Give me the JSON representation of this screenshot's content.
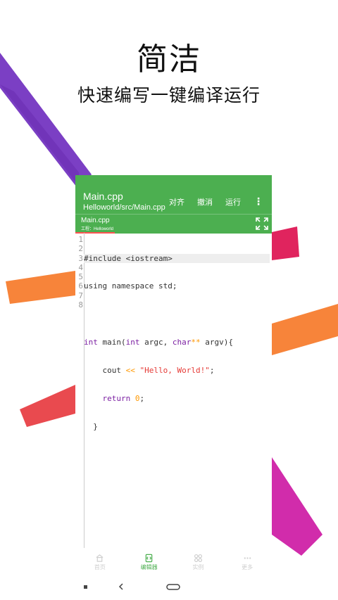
{
  "hero": {
    "title": "简洁",
    "subtitle": "快速编写一键编译运行"
  },
  "appbar": {
    "file_title": "Main.cpp",
    "file_path": "Helloworld/src/Main.cpp",
    "actions": [
      "对齐",
      "撤消",
      "运行"
    ]
  },
  "tab": {
    "name": "Main.cpp",
    "project": "工程：Helloworld"
  },
  "editor": {
    "line_numbers": [
      "1",
      "2",
      "3",
      "4",
      "5",
      "6",
      "7",
      "8"
    ],
    "code": {
      "l1": "#include <iostream>",
      "l2": "using namespace std;",
      "l4_kw1": "int",
      "l4_a": " main(",
      "l4_kw2": "int",
      "l4_b": " argc, ",
      "l4_kw3": "char",
      "l4_op": "**",
      "l4_c": " argv){",
      "l5_a": "    cout ",
      "l5_op": "<<",
      "l5_b": " ",
      "l5_str": "\"Hello, World!\"",
      "l5_c": ";",
      "l6_a": "    ",
      "l6_kw": "return",
      "l6_b": " ",
      "l6_num": "0",
      "l6_c": ";",
      "l7": "  }"
    }
  },
  "bottom_nav": {
    "items": [
      {
        "label": "首页",
        "icon": "home-icon"
      },
      {
        "label": "编辑器",
        "icon": "editor-icon"
      },
      {
        "label": "实例",
        "icon": "examples-icon"
      },
      {
        "label": "更多",
        "icon": "more-dots-icon"
      }
    ],
    "active": "编辑器"
  },
  "colors": {
    "accent": "#4caf50",
    "tab_indicator": "#ff5252",
    "keyword": "#7b1fa2",
    "operator": "#ff9800",
    "string": "#e53935"
  }
}
